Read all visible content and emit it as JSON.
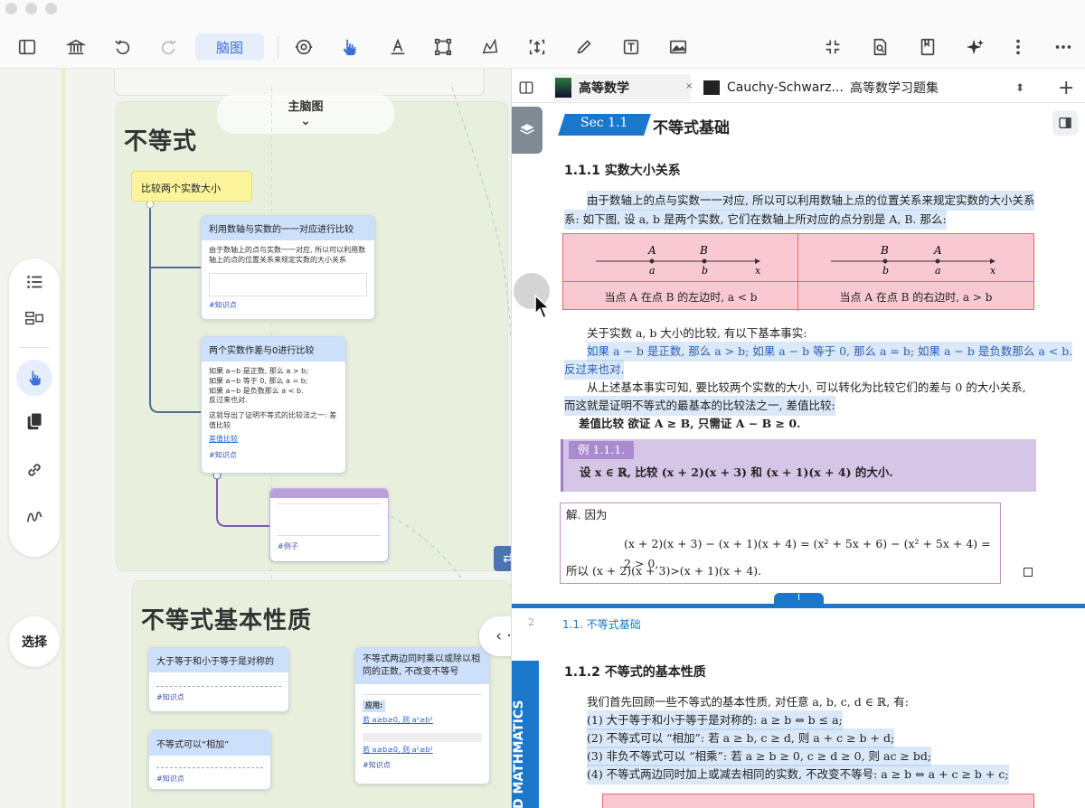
{
  "toolbar": {
    "mindmap_label": "脑图"
  },
  "mindmap": {
    "main_map_label": "主脑图",
    "select_label": "选择",
    "group1_title": "不等式",
    "group2_title": "不等式基本性质",
    "root_node": "比较两个实数大小",
    "card1": {
      "title": "利用数轴与实数的一一对应进行比较",
      "body": "由于数轴上的点与实数一一对应, 所以可以利用数轴上的点的位置关系来规定实数的大小关系",
      "tag": "#知识点"
    },
    "card2": {
      "title": "两个实数作差与0进行比较",
      "items": [
        "如果 a−b 是正数, 那么 a > b;",
        "如果 a−b 等于 0, 那么 a = b;",
        "如果 a−b 是负数那么 a < b.",
        "反过来也对."
      ],
      "note": "这就导出了证明不等式的比较法之一: 差值比较",
      "link": "差值比较",
      "tag": "#知识点"
    },
    "card3": {
      "tag": "#例子"
    },
    "card4": {
      "title": "大于等于和小于等于是对称的",
      "tag": "#知识点"
    },
    "card5": {
      "title": "不等式可以“相加”",
      "tag": "#知识点"
    },
    "card6": {
      "title": "不等式两边同时乘以或除以相同的正数, 不改变不等号",
      "apply": "应用:",
      "line1": "若 a≥b≥0, 则 a²≥b²",
      "line2": "若 a≥b≥0, 则 a²≥b²",
      "tag": "#知识点"
    }
  },
  "tabs": [
    {
      "label": "高等数学"
    },
    {
      "label": "Cauchy-Schwarz..."
    },
    {
      "label": "高等数学习题集"
    }
  ],
  "doc": {
    "sec_label": "Sec 1.1",
    "sec_title": "不等式基础",
    "sub1": "1.1.1   实数大小关系",
    "para1a": "由于数轴上的点与实数一一对应, 所以可以利用数轴上点的位置关系来规定实数的大小关系",
    "para1b": "系: 如下图, 设 a, b 是两个实数, 它们在数轴上所对应的点分别是 A, B. 那么:",
    "cap_left": "当点 A 在点 B 的左边时, a < b",
    "cap_right": "当点 A 在点 B 的右边时, a > b",
    "para2": "关于实数 a, b 大小的比较, 有以下基本事实:",
    "para3a": "如果 a − b 是正数, 那么 a > b; 如果 a − b 等于 0, 那么 a = b; 如果 a − b 是负数那么 a < b.",
    "para3b": "反过来也对.",
    "para4a": "从上述基本事实可知, 要比较两个实数的大小, 可以转化为比较它们的差与 0 的大小关系,",
    "para4b": "而这就是证明不等式的最基本的比较法之一, 差值比较:",
    "para5": "差值比较   欲证 A ≥ B, 只需证 A − B ≥ 0.",
    "example_label": "例 1.1.1.",
    "example_text": "设 x ∈ ℝ, 比较 (x + 2)(x + 3) 和 (x + 1)(x + 4) 的大小.",
    "sol_head": "解.   因为",
    "sol_eq": "(x + 2)(x + 3) − (x + 1)(x + 4) = (x² + 5x + 6) − (x² + 5x + 4) = 2 > 0,",
    "sol_end": "所以 (x + 2)(x + 3)>(x + 1)(x + 4).",
    "page_tab": "I",
    "running_head": "1.1.  不等式基础",
    "page_num": "2",
    "sub2": "1.1.2   不等式的基本性质",
    "para6": "我们首先回顾一些不等式的基本性质, 对任意 a, b, c, d ∈ ℝ, 有:",
    "prop1": "(1) 大于等于和小于等于是对称的: a ≥ b ⇔ b ≤ a;",
    "prop2": "(2) 不等式可以 “相加”: 若 a ≥ b, c ≥ d, 则 a + c ≥ b + d;",
    "prop3": "(3) 非负不等式可以 “相乘”: 若 a ≥ b ≥ 0, c ≥ d ≥ 0, 则 ac ≥ bd;",
    "prop4": "(4) 不等式两边同时加上或减去相同的实数, 不改变不等号: a ≥ b ⇔ a + c ≥ b + c;",
    "side_label": "D MATHMATICS"
  }
}
